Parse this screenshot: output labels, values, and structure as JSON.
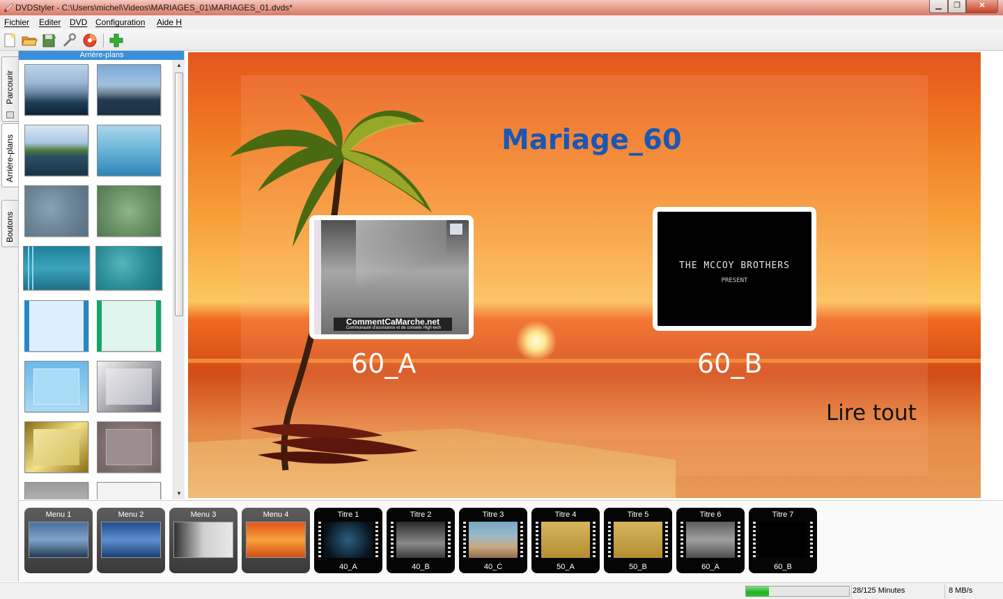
{
  "window": {
    "title": "DVDStyler - C:\\Users\\michel\\Videos\\MARIAGES_01\\MARIAGES_01.dvds*",
    "minimize_icon": "minimize-icon",
    "maximize_icon": "maximize-icon",
    "close_icon": "close-icon"
  },
  "menubar": {
    "items": [
      "Fichier",
      "Editer",
      "DVD",
      "Configuration",
      "Aide H"
    ]
  },
  "toolbar": {
    "icons": [
      "new-file-icon",
      "open-folder-icon",
      "save-icon",
      "settings-wrench-icon",
      "burn-disc-icon",
      "add-icon"
    ]
  },
  "vtabs": {
    "items": [
      "Parcourir",
      "Arrière-plans",
      "Boutons"
    ],
    "active": "Arrière-plans"
  },
  "backgrounds_panel": {
    "header": "Arrière-plans",
    "thumbnails": [
      "sea-rocks",
      "boat-bay",
      "lake-forest",
      "blue-haze",
      "gray-blue-texture",
      "green-texture",
      "teal-stripes",
      "teal-texture",
      "light-blue-frame",
      "green-frame",
      "blue-frame",
      "silver-frame",
      "gold-frame",
      "red-gray-frame",
      "gray-gradient",
      "white-texture"
    ]
  },
  "menu_canvas": {
    "title": "Mariage_60",
    "buttons": [
      {
        "label": "60_A",
        "thumb_caption": "CommentCaMarche.net",
        "thumb_subcaption": "Communauté d'assistance et de conseils High-tech"
      },
      {
        "label": "60_B",
        "thumb_line1": "THE MCCOY BROTHERS",
        "thumb_line2": "PRESENT"
      }
    ],
    "play_all": "Lire tout"
  },
  "titleset_strip": {
    "items": [
      {
        "label": "Menu 1",
        "kind": "menu",
        "sub": ""
      },
      {
        "label": "Menu 2",
        "kind": "menu",
        "sub": ""
      },
      {
        "label": "Menu 3",
        "kind": "menu",
        "sub": ""
      },
      {
        "label": "Menu 4",
        "kind": "menu",
        "sub": ""
      },
      {
        "label": "Titre 1",
        "kind": "title",
        "sub": "40_A"
      },
      {
        "label": "Titre 2",
        "kind": "title",
        "sub": "40_B"
      },
      {
        "label": "Titre 3",
        "kind": "title",
        "sub": "40_C"
      },
      {
        "label": "Titre 4",
        "kind": "title",
        "sub": "50_A"
      },
      {
        "label": "Titre 5",
        "kind": "title",
        "sub": "50_B"
      },
      {
        "label": "Titre 6",
        "kind": "title",
        "sub": "60_A"
      },
      {
        "label": "Titre 7",
        "kind": "title",
        "sub": "60_B"
      }
    ]
  },
  "status": {
    "minutes": "28/125 Minutes",
    "rate": "8 MB/s",
    "progress": 0.224
  },
  "colors": {
    "accent": "#3c8fd9",
    "title_text": "#1a57b6",
    "progress": "#21b021"
  }
}
